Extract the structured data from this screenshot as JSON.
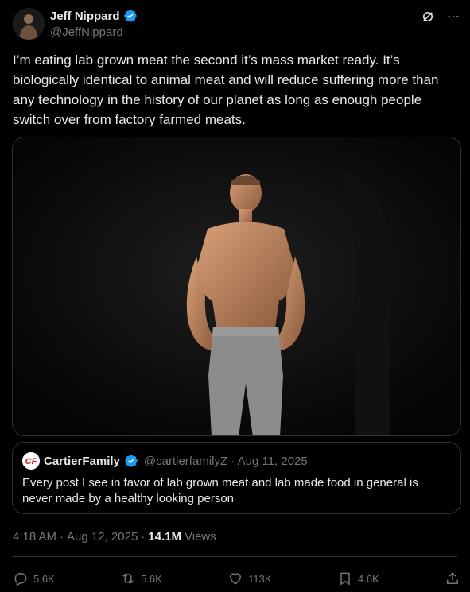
{
  "author": {
    "display_name": "Jeff Nippard",
    "handle": "@JeffNippard",
    "verified": true
  },
  "tweet": {
    "text": "I’m eating lab grown meat the second it’s mass market ready. It’s biologically identical to animal meat and will reduce suffering more than any technology in the history of our planet as long as enough people switch over from factory farmed meats."
  },
  "quote": {
    "display_name": "CartierFamily",
    "handle": "@cartierfamilyZ",
    "date": "Aug 11, 2025",
    "text": "Every post I see in favor of lab grown meat and lab made food in general is never made by a healthy looking person",
    "avatar_text": "CF"
  },
  "meta": {
    "time": "4:18 AM",
    "date": "Aug 12, 2025",
    "views_count": "14.1M",
    "views_label": "Views",
    "sep": "·"
  },
  "actions": {
    "replies": "5.6K",
    "reposts": "5.6K",
    "likes": "113K",
    "bookmarks": "4.6K"
  },
  "colors": {
    "background": "#000000",
    "text": "#e7e9ea",
    "muted": "#71767b",
    "border": "#2f3336",
    "verified": "#1d9bf0",
    "quote_avatar": "#d41a1a"
  },
  "icons": {
    "verified": "verified-badge-icon",
    "grok": "grok-icon",
    "more": "more-icon",
    "reply": "reply-icon",
    "repost": "repost-icon",
    "like": "heart-icon",
    "bookmark": "bookmark-icon",
    "share": "share-icon"
  }
}
